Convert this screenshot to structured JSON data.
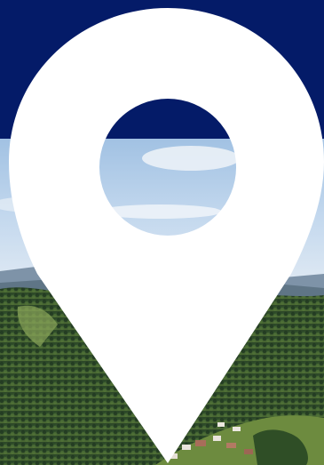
{
  "colors": {
    "header_navy": "#041b68",
    "pin_white": "#ffffff",
    "sky_light": "#cfe0f1",
    "sky_mid": "#a9c8e6",
    "mountain_haze": "#7d93ab",
    "forest_dark": "#233b22",
    "forest_mid": "#3d5a2e",
    "forest_light": "#6c8a43",
    "village_roof": "#a86d5a"
  },
  "icons": {
    "pin": "map-pin-icon"
  }
}
